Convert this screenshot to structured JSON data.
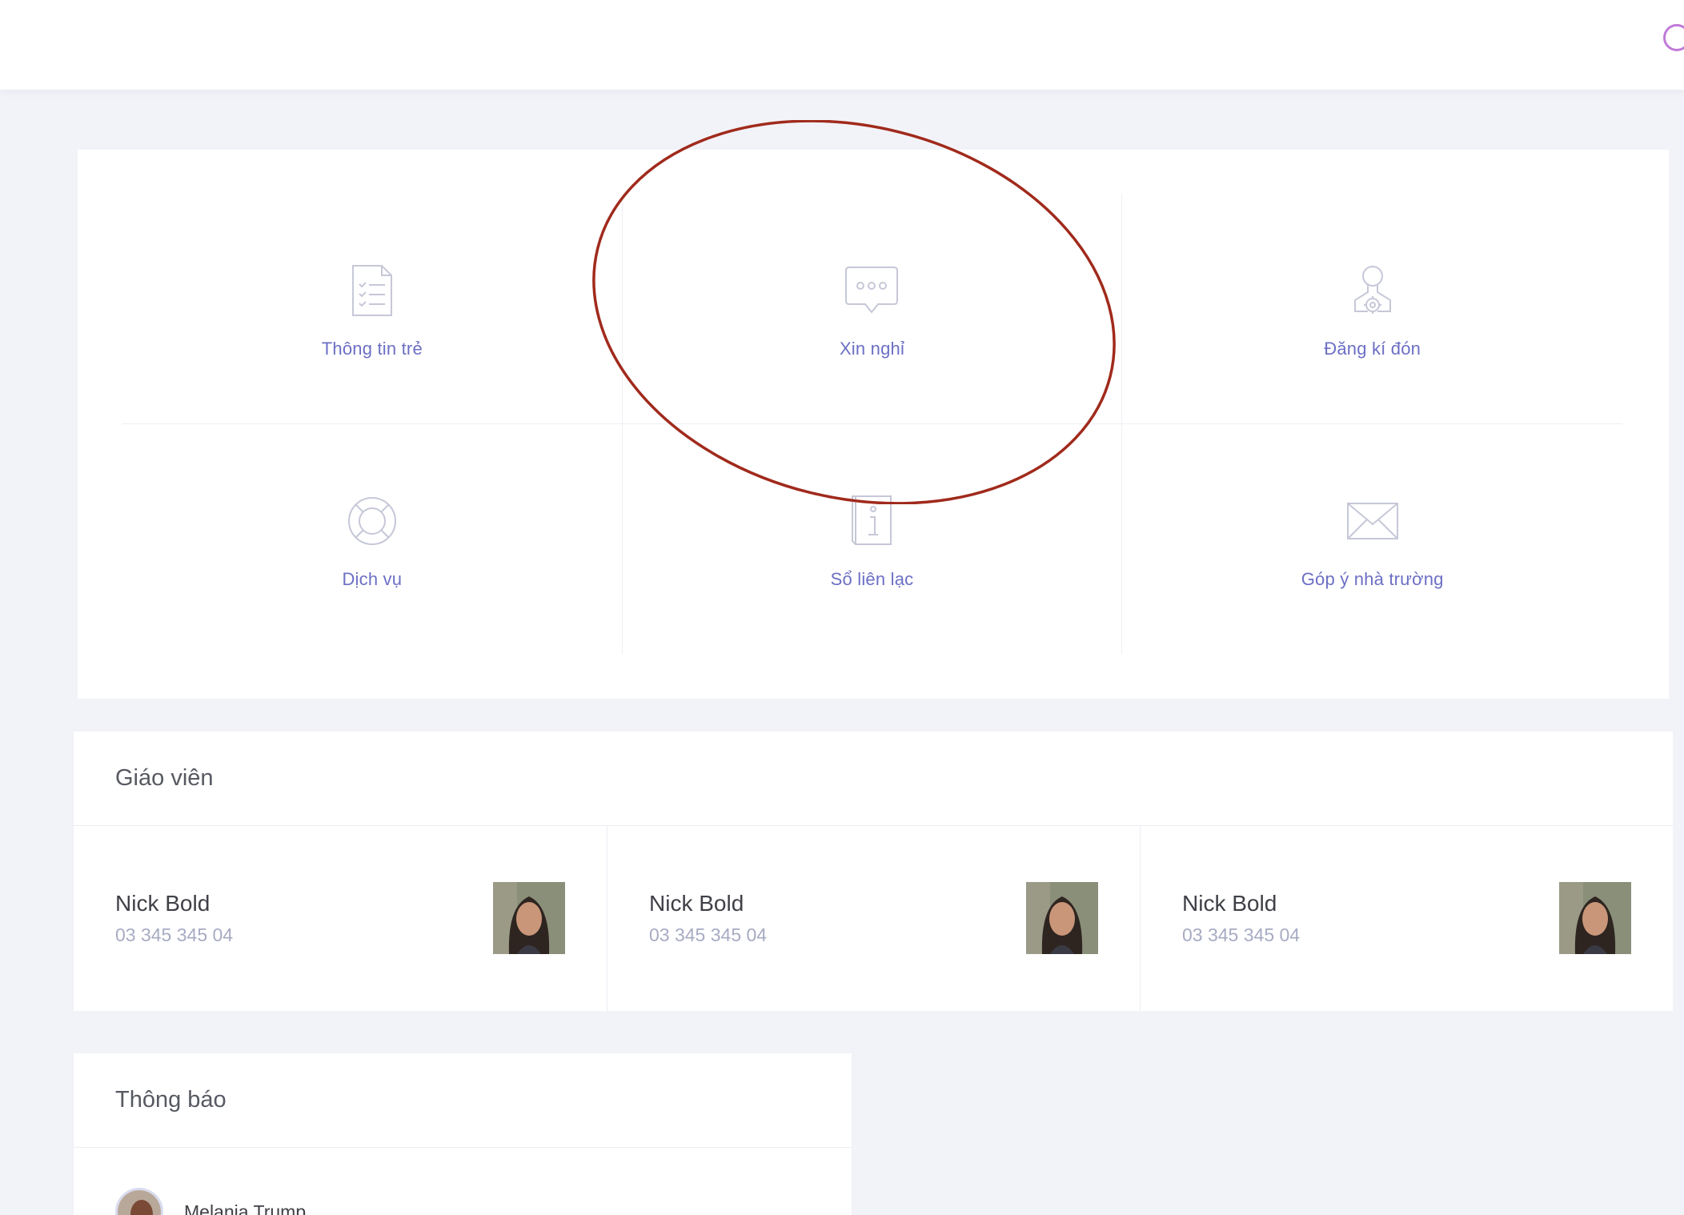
{
  "menu": {
    "items": [
      {
        "label": "Thông tin trẻ",
        "icon": "checklist-document-icon"
      },
      {
        "label": "Xin nghỉ",
        "icon": "chat-bubble-icon"
      },
      {
        "label": "Đăng kí đón",
        "icon": "user-settings-icon"
      },
      {
        "label": "Dịch vụ",
        "icon": "lifebuoy-icon"
      },
      {
        "label": "Sổ liên lạc",
        "icon": "info-book-icon"
      },
      {
        "label": "Góp ý nhà trường",
        "icon": "envelope-icon"
      }
    ]
  },
  "teachers": {
    "title": "Giáo viên",
    "items": [
      {
        "name": "Nick Bold",
        "phone": "03 345 345 04"
      },
      {
        "name": "Nick Bold",
        "phone": "03 345 345 04"
      },
      {
        "name": "Nick Bold",
        "phone": "03 345 345 04"
      }
    ]
  },
  "notices": {
    "title": "Thông báo",
    "items": [
      {
        "name": "Melania Trump"
      }
    ]
  },
  "colors": {
    "accent": "#6c6fc4",
    "annotation": "#a02a1c",
    "loader": "#c07ad8",
    "background": "#f2f3f8"
  }
}
